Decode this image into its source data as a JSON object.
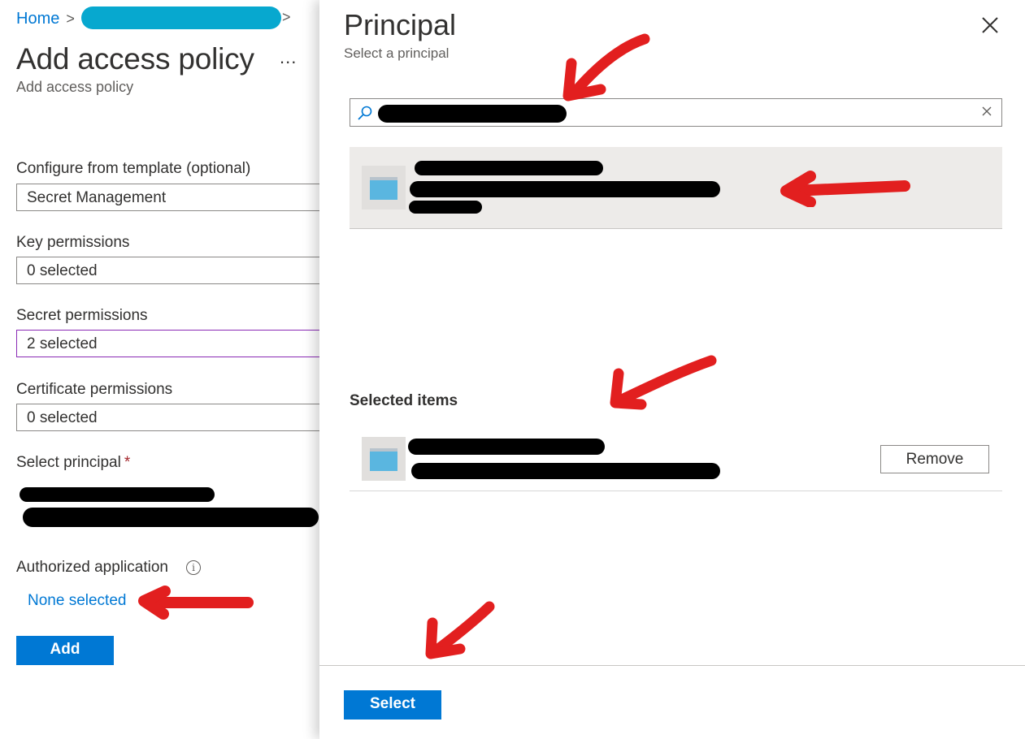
{
  "breadcrumb": {
    "home": "Home",
    "separator": ">"
  },
  "blade": {
    "title": "Add access policy",
    "more": "...",
    "subtitle": "Add access policy"
  },
  "form": {
    "template": {
      "label": "Configure from template (optional)",
      "value": "Secret Management"
    },
    "key_permissions": {
      "label": "Key permissions",
      "value": "0 selected"
    },
    "secret_permissions": {
      "label": "Secret permissions",
      "value": "2 selected"
    },
    "certificate_permissions": {
      "label": "Certificate permissions",
      "value": "0 selected"
    },
    "select_principal": {
      "label": "Select principal",
      "required_mark": "*"
    },
    "authorized_application": {
      "label": "Authorized application",
      "info": "i",
      "value": "None selected"
    },
    "add_button": "Add"
  },
  "panel": {
    "title": "Principal",
    "subtitle": "Select a principal",
    "search": {
      "value": "",
      "placeholder": ""
    },
    "selected_items_heading": "Selected items",
    "remove_button": "Remove",
    "select_button": "Select"
  },
  "colors": {
    "accent": "#0078d4",
    "annotation_red": "#e21f1f",
    "redaction_cyan": "#07a8cf",
    "redaction_black": "#000000"
  }
}
